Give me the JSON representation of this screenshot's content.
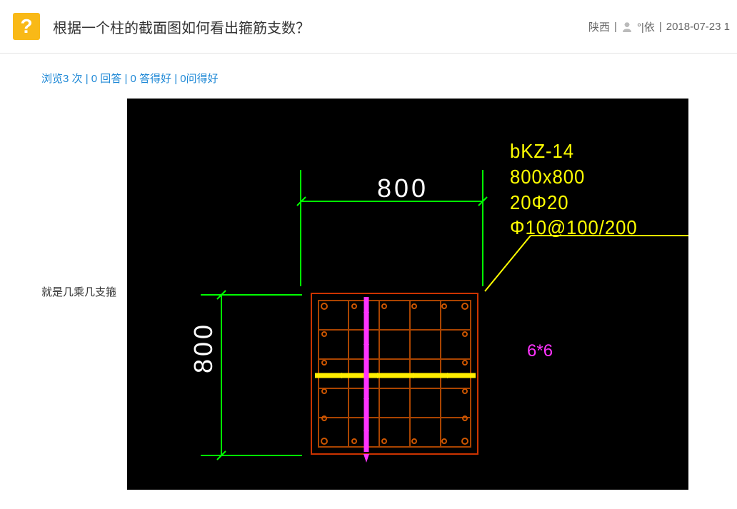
{
  "header": {
    "icon_glyph": "?",
    "title": "根据一个柱的截面图如何看出箍筋支数？",
    "location": "陕西",
    "username": "°|依",
    "date": "2018-07-23 1"
  },
  "stats": {
    "views_label": "浏览3 次",
    "answers_label": "0 回答",
    "good_answers_label": "0 答得好",
    "good_questions_label": "0问得好",
    "sep": " | "
  },
  "body": {
    "desc": "就是几乘几支箍"
  },
  "cad": {
    "dim_top": "800",
    "dim_left": "800",
    "label_line1": "bKZ-14",
    "label_line2": "800x800",
    "label_line3": "20Φ20",
    "label_line4": "Φ10@100/200",
    "annot": "6*6"
  }
}
